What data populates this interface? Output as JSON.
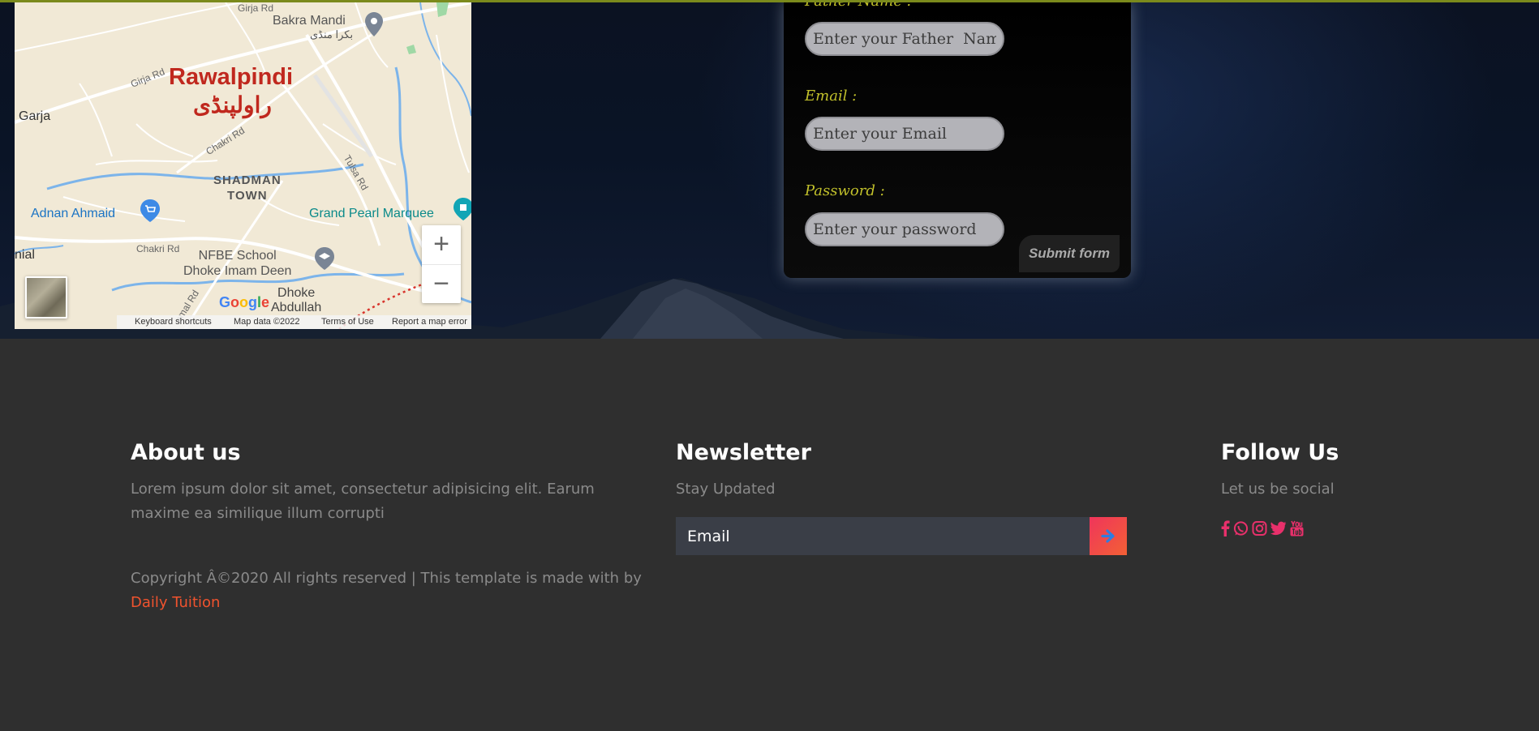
{
  "map": {
    "city_name": "Rawalpindi",
    "city_name_urdu": "راولپنڈی",
    "labels": {
      "bakra_mandi": "Bakra Mandi",
      "bakra_mandi_urdu": "بکرا منڈی",
      "garja": "Garja",
      "shadman_town": "SHADMAN\nTOWN",
      "adnan_ahmaid": "Adnan Ahmaid",
      "grand_pearl": "Grand Pearl Marquee",
      "nfbe_school": "NFBE School\nDhoke Imam Deen",
      "dhoke_abdullah": "Dhoke\nAbdullah",
      "nial": "nial",
      "chakri_rd_1": "Chakri Rd",
      "chakri_rd_2": "Chakri Rd",
      "girja_rd": "Girja Rd",
      "girja_rd_top": "Girja Rd",
      "tulsa_rd": "Tulsa Rd",
      "jamal_rd": "amal Rd"
    },
    "zoom_in": "+",
    "zoom_out": "−",
    "google_logo": "Google",
    "footer": {
      "keyboard_shortcuts": "Keyboard shortcuts",
      "map_data": "Map data ©2022",
      "terms": "Terms of Use",
      "report": "Report a map error"
    },
    "colors": {
      "land": "#f1e9d6",
      "roads": "#ffffff",
      "water": "#7cb4ea",
      "city_label": "#c0281e"
    }
  },
  "form": {
    "father_name_label": "Father Name :",
    "father_name_placeholder": "Enter your Father  Name",
    "email_label": "Email :",
    "email_placeholder": "Enter your Email",
    "password_label": "Password :",
    "password_placeholder": "Enter your password",
    "submit_label": "Submit form",
    "colors": {
      "label": "#c1c02b",
      "input_bg": "#b3b3b8"
    }
  },
  "footer": {
    "about": {
      "title": "About us",
      "text": "Lorem ipsum dolor sit amet, consectetur adipisicing elit. Earum maxime ea similique illum corrupti"
    },
    "copyright": {
      "text": "Copyright Â©2020 All rights reserved | This template is made with by",
      "link": "Daily Tuition"
    },
    "newsletter": {
      "title": "Newsletter",
      "subtitle": "Stay Updated",
      "email_placeholder": "Email",
      "submit_icon": "arrow-right-icon"
    },
    "follow": {
      "title": "Follow Us",
      "subtitle": "Let us be social",
      "icons": [
        "facebook-icon",
        "whatsapp-icon",
        "instagram-icon",
        "twitter-icon",
        "youtube-icon"
      ]
    },
    "colors": {
      "background": "#2f2f2f",
      "accent": "#f0355b",
      "link": "#f0532e"
    }
  }
}
